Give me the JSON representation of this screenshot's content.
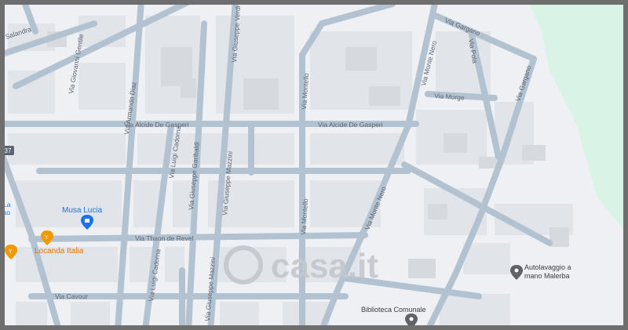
{
  "map": {
    "colors": {
      "background": "#eef0f3",
      "block": "#e1e4e8",
      "building": "#d6d9de",
      "road": "#b3c2d1",
      "road_edge": "#a9b8c7",
      "park": "#d9f3e6",
      "label": "#5b6573",
      "poi_blue": "#1a73e8",
      "poi_orange": "#f29900",
      "poi_gray": "#5f6368",
      "watermark": "#c4c8ce"
    },
    "streets": {
      "salandra": "Salandra",
      "giovanni_gentile": "Via Giovanni Gentile",
      "armando_diaz": "Via Armando Diaz",
      "giuseppe_verdi": "Via Giuseppe Verdi",
      "alcide_de_gasperi_w": "Via Alcide De Gasperi",
      "alcide_de_gasperi_e": "Via Alcide De Gasperi",
      "monte_nero_n": "Via Monte Nero",
      "monte_nero_s": "Via Monte Nero",
      "gargano_n": "Via Gargano",
      "gargano_e": "Via Gargano",
      "pola": "Via Pola",
      "murge": "Via Murge",
      "montello_n": "Via Montello",
      "montello_s": "Via Montello",
      "luigi_cadorna_n": "Via Luigi Cadorna",
      "luigi_cadorna_s": "Via Luigi Cadorna",
      "giuseppe_garibaldi": "Via Giuseppe Garibaldi",
      "giuseppe_mazzini_n": "Via Giuseppe Mazzini",
      "giuseppe_mazzini_s": "Via Giuseppe Mazzini",
      "thaon_de_revel": "Via Thaon de Revel",
      "cavour": "Via Cavour",
      "road_number": "37",
      "edge_label": "La\nso"
    },
    "pois": [
      {
        "name": "Musa Lucia",
        "icon": "shop-pin-icon",
        "color": "#1a73e8"
      },
      {
        "name": "Locanda Italia",
        "icon": "restaurant-pin-icon",
        "color": "#f29900"
      },
      {
        "name": "",
        "icon": "restaurant-pin-icon",
        "color": "#f29900"
      },
      {
        "name": "Autolavaggio a mano Malerba",
        "icon": "place-pin-icon",
        "color": "#5f6368"
      },
      {
        "name": "Biblioteca Comunale",
        "icon": "library-pin-icon",
        "color": "#5f6368"
      }
    ],
    "watermark": "casa.it"
  }
}
